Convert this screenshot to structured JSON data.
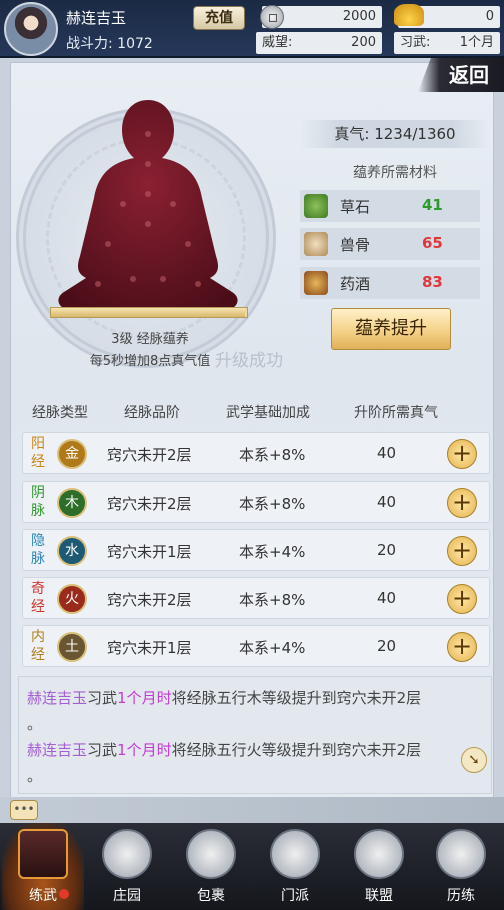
{
  "player": {
    "name": "赫连吉玉",
    "power_label": "战斗力:",
    "power_value": "1072",
    "recharge": "充值"
  },
  "resources": {
    "silver": "2000",
    "gold": "0",
    "prestige_label": "威望:",
    "prestige_value": "200",
    "practice_label": "习武:",
    "practice_value": "1个月"
  },
  "back_button": "返回",
  "meditation": {
    "progress": 0.99,
    "level_text": "3级 经脉蕴养",
    "rate_text": "每5秒增加8点真气值",
    "upgrade_ghost": "升级成功"
  },
  "zhenqi": "真气: 1234/1360",
  "materials": {
    "title": "蕴养所需材料",
    "items": [
      {
        "name": "草石",
        "count": "41",
        "color": "#2e9a2a",
        "icon": "herb-icon"
      },
      {
        "name": "兽骨",
        "count": "65",
        "color": "#e0373a",
        "icon": "bone-icon"
      },
      {
        "name": "药酒",
        "count": "83",
        "color": "#e0373a",
        "icon": "wine-gourd-icon"
      }
    ],
    "button": "蕴养提升"
  },
  "table": {
    "headers": [
      "经脉类型",
      "经脉品阶",
      "武学基础加成",
      "升阶所需真气"
    ],
    "rows": [
      {
        "type": "阳经",
        "type_color": "#c8861a",
        "element": "金",
        "elem_color": "#b07a1a",
        "grade": "窍穴未开2层",
        "bonus": "本系+8%",
        "cost": "40"
      },
      {
        "type": "阴脉",
        "type_color": "#2e9a2a",
        "element": "木",
        "elem_color": "#2f6e2a",
        "grade": "窍穴未开2层",
        "bonus": "本系+8%",
        "cost": "40"
      },
      {
        "type": "隐脉",
        "type_color": "#2a86b8",
        "element": "水",
        "elem_color": "#1f5a74",
        "grade": "窍穴未开1层",
        "bonus": "本系+4%",
        "cost": "20"
      },
      {
        "type": "奇经",
        "type_color": "#d0342a",
        "element": "火",
        "elem_color": "#9a2a1c",
        "grade": "窍穴未开2层",
        "bonus": "本系+8%",
        "cost": "40"
      },
      {
        "type": "内经",
        "type_color": "#b0801e",
        "element": "土",
        "elem_color": "#6a5632",
        "grade": "窍穴未开1层",
        "bonus": "本系+4%",
        "cost": "20"
      }
    ]
  },
  "log": [
    {
      "player": "赫连吉玉",
      "verb": "习武",
      "time": "1个月时",
      "rest": "将经脉五行木等级提升到窍穴未开2层",
      "end": "。"
    },
    {
      "player": "赫连吉玉",
      "verb": "习武",
      "time": "1个月时",
      "rest": "将经脉五行火等级提升到窍穴未开2层",
      "end": "。"
    }
  ],
  "chat_button": "•••",
  "nav": [
    {
      "label": "练武",
      "icon": "martial-icon"
    },
    {
      "label": "庄园",
      "icon": "manor-icon"
    },
    {
      "label": "包裹",
      "icon": "bag-icon"
    },
    {
      "label": "门派",
      "icon": "sect-icon"
    },
    {
      "label": "联盟",
      "icon": "alliance-icon"
    },
    {
      "label": "历练",
      "icon": "training-icon"
    }
  ]
}
